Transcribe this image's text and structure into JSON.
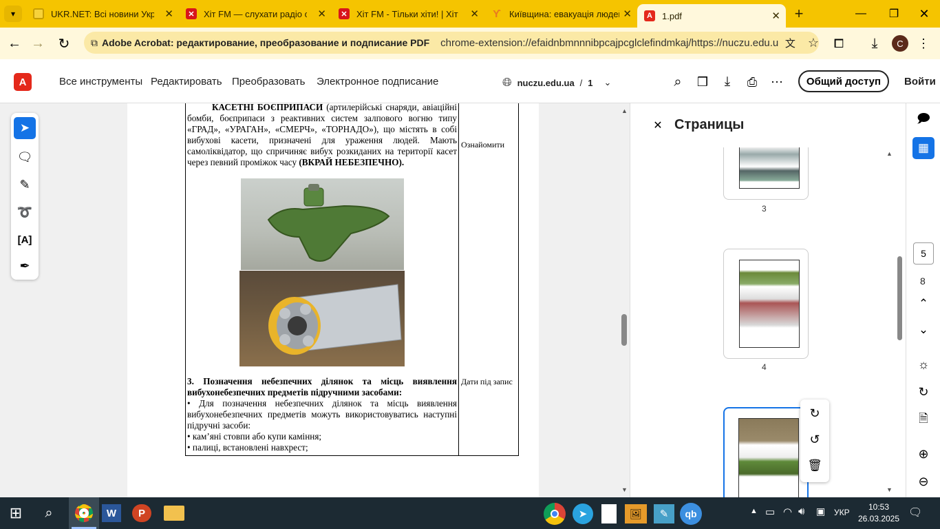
{
  "browser": {
    "tabs": [
      {
        "title": "UKR.NET: Всі новини Украї",
        "icon": "ukrnet-icon"
      },
      {
        "title": "Хіт FM — слухати радіо онл",
        "icon": "hitfm-icon"
      },
      {
        "title": "Хіт FM - Тільки хіти! | Хіт FM",
        "icon": "hitfm-icon"
      },
      {
        "title": "Київщина: евакуація людей",
        "icon": "news-icon"
      },
      {
        "title": "1.pdf",
        "icon": "acrobat-icon"
      }
    ],
    "extension_label": "Adobe Acrobat: редактирование, преобразование и подписание PDF",
    "url": "chrome-extension://efaidnbmnnnibpcajpcglclefindmkaj/https://nuczu.edu.ua/images/to...",
    "profile_initial": "C"
  },
  "acrobat": {
    "menu": [
      "Все инструменты",
      "Редактировать",
      "Преобразовать",
      "Электронное подписание"
    ],
    "doc_source": "nuczu.edu.ua",
    "doc_sep": "/",
    "doc_page": "1",
    "share_button": "Общий доступ",
    "signin": "Войти"
  },
  "document": {
    "para1_bold": "КАСЕТНІ БОЄПРИПАСИ",
    "para1_text": " (артилерійські снаряди, авіаційні бомби, боєприпаси з реактивних систем залпового вогню типу «ГРАД», «УРАГАН», «СМЕРЧ», «ТОРНАДО»), що містять в собі вибухові касети, призначені для ураження людей. Мають самоліквідатор, що спричиняє вибух розкиданих на території касет через певний проміжок часу ",
    "para1_end": "(ВКРАЙ НЕБЕЗПЕЧНО).",
    "col2_row1": "Ознайомити",
    "section3_title": "3. Позначення небезпечних ділянок та місць виявлення вибухонебезпечних предметів підручними засобами:",
    "section3_text": "•    Для позначення небезпечних ділянок та місць виявлення вибухонебезпечних предметів можуть використовуватись наступні підручні засоби:",
    "bullet1": "•    кам’яні стовпи або купи каміння;",
    "bullet2": "•    палиці, встановлені навхрест;",
    "col2_row2": "Дати під запис"
  },
  "pages_panel": {
    "title": "Страницы",
    "thumbs": [
      "3",
      "4"
    ]
  },
  "right_rail": {
    "current_page": "5",
    "total_pages": "8"
  },
  "taskbar": {
    "lang": "УКР",
    "time": "10:53",
    "date": "26.03.2025"
  },
  "colors": {
    "chrome_yellow": "#f5c400",
    "acrobat_red": "#e4291b",
    "selection_blue": "#1473e6"
  }
}
